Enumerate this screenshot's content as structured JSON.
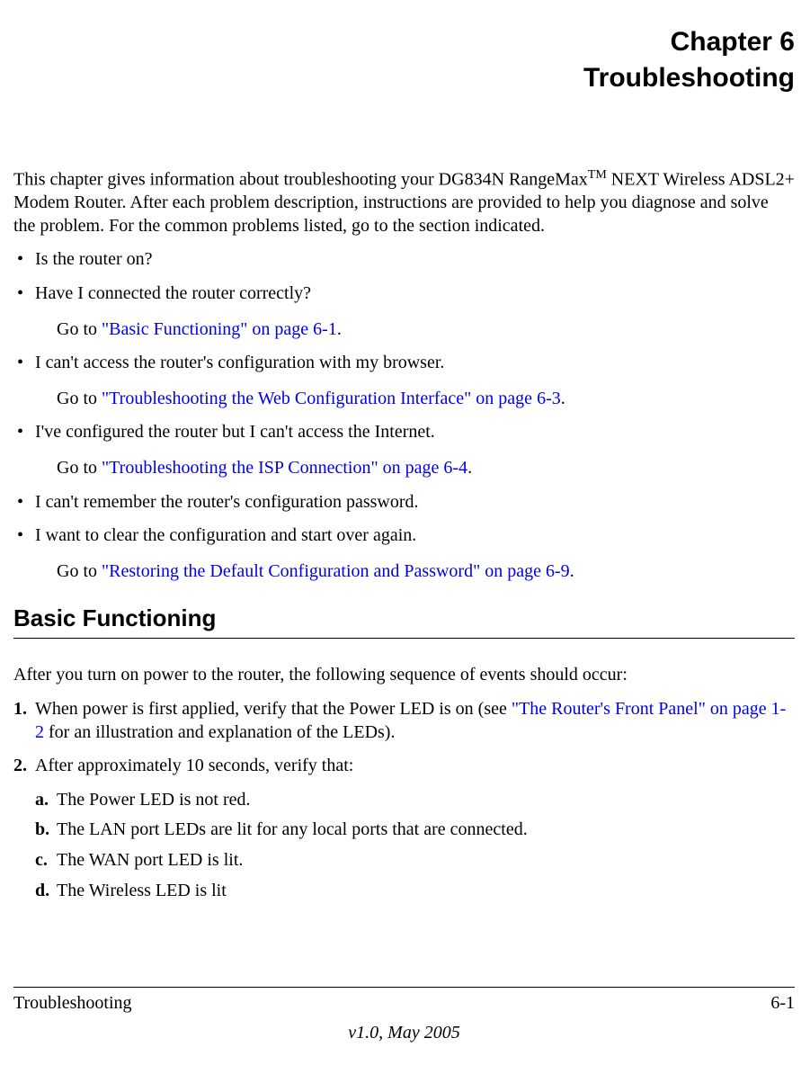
{
  "header": {
    "chapter_number": "Chapter 6",
    "chapter_title": "Troubleshooting"
  },
  "intro_parts": {
    "before_tm": "This chapter gives information about troubleshooting your DG834N RangeMax",
    "tm": "TM",
    "after_tm": " NEXT Wireless ADSL2+ Modem Router. After each problem description, instructions are provided to help you diagnose and solve the problem. For the common problems listed, go to the section indicated."
  },
  "bullets": [
    {
      "text": "Is the router on?"
    },
    {
      "text": "Have I connected the router correctly?"
    }
  ],
  "goto1": {
    "prefix": "Go to ",
    "link": "\"Basic Functioning\" on page 6-1",
    "suffix": "."
  },
  "bullet3": {
    "text": "I can't access the router's configuration with my browser."
  },
  "goto2": {
    "prefix": "Go to ",
    "link": "\"Troubleshooting the Web Configuration Interface\" on page 6-3",
    "suffix": "."
  },
  "bullet4": {
    "text": "I've configured the router but I can't access the Internet."
  },
  "goto3": {
    "prefix": "Go to ",
    "link": "\"Troubleshooting the ISP Connection\" on page 6-4",
    "suffix": "."
  },
  "bullet5": {
    "text": "I can't remember the router's configuration password."
  },
  "bullet6": {
    "text": "I want to clear the configuration and start over again."
  },
  "goto4": {
    "prefix": "Go to ",
    "link": "\"Restoring the Default Configuration and Password\" on page 6-9",
    "suffix": "."
  },
  "section_heading": "Basic Functioning",
  "section_intro": "After you turn on power to the router, the following sequence of events should occur:",
  "step1": {
    "marker": "1.",
    "before_link": "When power is first applied, verify that the Power LED is on (see ",
    "link": "\"The Router's Front Panel\" on page 1-2",
    "after_link": " for an illustration and explanation of the LEDs)."
  },
  "step2": {
    "marker": "2.",
    "text": "After approximately 10 seconds, verify that:"
  },
  "substeps": [
    {
      "marker": "a.",
      "text": "The Power LED is not red."
    },
    {
      "marker": "b.",
      "text": "The LAN port LEDs are lit for any local ports that are connected."
    },
    {
      "marker": "c.",
      "text": "The WAN port LED is lit."
    },
    {
      "marker": "d.",
      "text": "The Wireless LED is lit"
    }
  ],
  "footer": {
    "left": "Troubleshooting",
    "right": "6-1",
    "version": "v1.0, May 2005"
  }
}
